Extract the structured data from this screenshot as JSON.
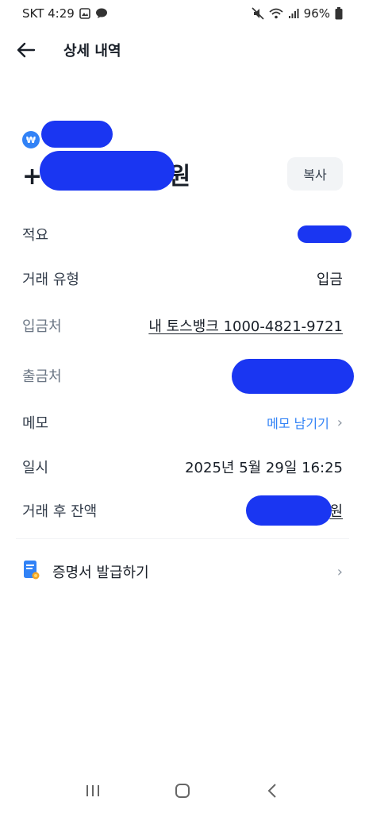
{
  "status": {
    "carrier_time": "SKT 4:29",
    "battery": "96%"
  },
  "header": {
    "title": "상세 내역"
  },
  "transaction": {
    "account_name": "",
    "amount_prefix": "+",
    "amount_suffix": "원",
    "copy_label": "복사"
  },
  "details": [
    {
      "label": "적요",
      "value": ""
    },
    {
      "label": "거래 유형",
      "value": "입금"
    },
    {
      "label": "입금처",
      "value": "내 토스뱅크 1000-4821-9721"
    },
    {
      "label": "출금처",
      "value": ""
    },
    {
      "label": "메모",
      "value": "메모 남기기"
    },
    {
      "label": "일시",
      "value": "2025년 5월 29일 16:25"
    },
    {
      "label": "거래 후 잔액",
      "value": "원"
    }
  ],
  "certificate": {
    "label": "증명서 발급하기"
  },
  "colors": {
    "accent": "#3182f6",
    "redaction": "#1a36f2"
  }
}
